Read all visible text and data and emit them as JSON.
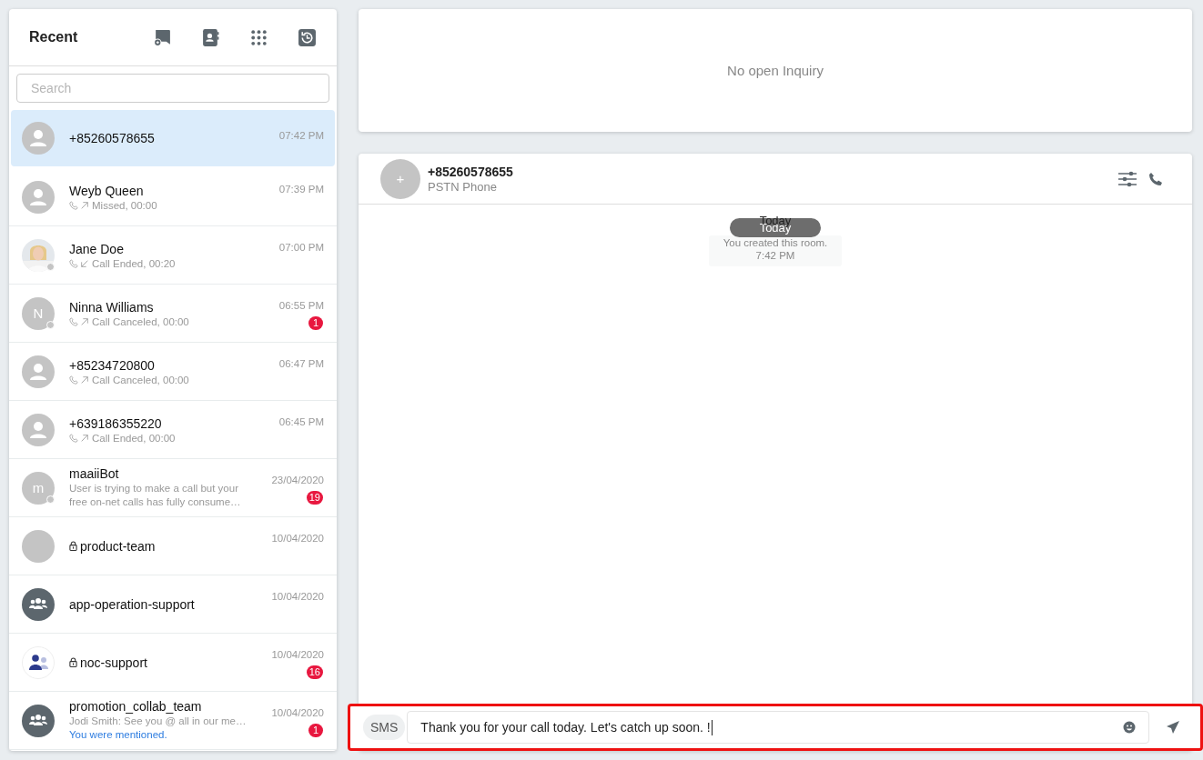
{
  "sidebar": {
    "title": "Recent",
    "toolbar": [
      {
        "kind": "new-chat"
      },
      {
        "kind": "contacts"
      },
      {
        "kind": "dialpad"
      },
      {
        "kind": "history"
      }
    ],
    "search": {
      "placeholder": "Search"
    },
    "conversations": [
      {
        "name": "+85260578655",
        "time": "07:42 PM",
        "selected": true,
        "avatar": {
          "kind": "person"
        },
        "presence": false
      },
      {
        "name": "Weyb Queen",
        "time": "07:39 PM",
        "selected": false,
        "avatar": {
          "kind": "person"
        },
        "presence": false,
        "call": {
          "outgoing": true,
          "text": "Missed, 00:00"
        }
      },
      {
        "name": "Jane Doe",
        "time": "07:00 PM",
        "selected": false,
        "presence": true,
        "call": {
          "outgoing": false,
          "text": "Call Ended, 00:20"
        }
      },
      {
        "name": "Ninna Williams",
        "time": "06:55 PM",
        "selected": false,
        "avatar": {
          "kind": "letter",
          "letter": "N"
        },
        "presence": true,
        "call": {
          "outgoing": true,
          "text": "Call Canceled, 00:00"
        },
        "badge": "1"
      },
      {
        "name": "+85234720800",
        "time": "06:47 PM",
        "selected": false,
        "avatar": {
          "kind": "person"
        },
        "presence": false,
        "call": {
          "outgoing": true,
          "text": "Call Canceled, 00:00"
        }
      },
      {
        "name": "+639186355220",
        "time": "06:45 PM",
        "selected": false,
        "avatar": {
          "kind": "person"
        },
        "presence": false,
        "call": {
          "outgoing": true,
          "text": "Call Ended, 00:00"
        }
      },
      {
        "name": "maaiiBot",
        "time": "23/04/2020",
        "selected": false,
        "avatar": {
          "kind": "letter",
          "letter": "m"
        },
        "presence": true,
        "preview": "User is trying to make a call but your free on-net calls has fully consume…",
        "badge": "19"
      },
      {
        "name": "product-team",
        "time": "10/04/2020",
        "selected": false,
        "avatar": {
          "kind": "blank"
        },
        "presence": false,
        "locked": true
      },
      {
        "name": "app-operation-support",
        "time": "10/04/2020",
        "selected": false,
        "avatar": {
          "kind": "group"
        },
        "presence": false,
        "locked": false
      },
      {
        "name": "noc-support",
        "time": "10/04/2020",
        "selected": false,
        "avatar": {
          "kind": "team"
        },
        "presence": false,
        "locked": true,
        "badge": "16"
      },
      {
        "name": "promotion_collab_team",
        "time": "10/04/2020",
        "selected": false,
        "avatar": {
          "kind": "group"
        },
        "presence": false,
        "preview": "Jodi Smith: See you @ all in our me…",
        "mention": "You were mentioned.",
        "badge": "1"
      }
    ]
  },
  "inquiry": {
    "text": "No open Inquiry"
  },
  "chat": {
    "avatar_letter": "+",
    "title": "+85260578655",
    "subtitle": "PSTN Phone",
    "date_label": "Today",
    "date_pill": "Today",
    "system_message": "You created this room.",
    "system_time": "7:42 PM",
    "composer": {
      "channel": "SMS",
      "value": "Thank you for your call today. Let's catch up soon. !",
      "highlighted": true
    }
  }
}
